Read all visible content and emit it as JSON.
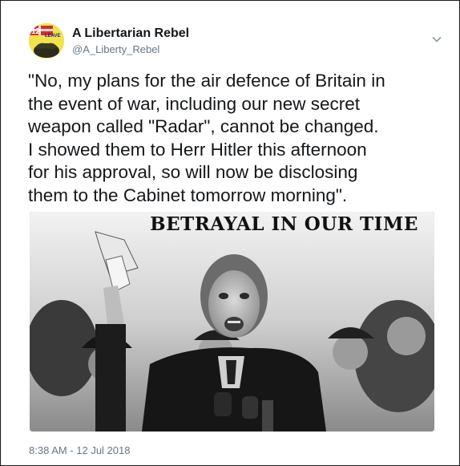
{
  "author": {
    "display_name": "A Libertarian Rebel",
    "handle": "@A_Liberty_Rebel",
    "avatar_badge": "LEAVE",
    "avatar_number": "12"
  },
  "tweet": {
    "text": "\"No, my plans for the air defence of Britain in\nthe event of war, including our new secret\nweapon called \"Radar\", cannot be changed.\nI showed them to Herr Hitler this afternoon\nfor his approval, so will now be disclosing\nthem to the Cabinet tomorrow morning\".",
    "timestamp": "8:38 AM - 12 Jul 2018"
  },
  "media": {
    "caption": "BETRAYAL IN OUR TIME"
  },
  "icons": {
    "menu": "chevron-down-icon"
  }
}
